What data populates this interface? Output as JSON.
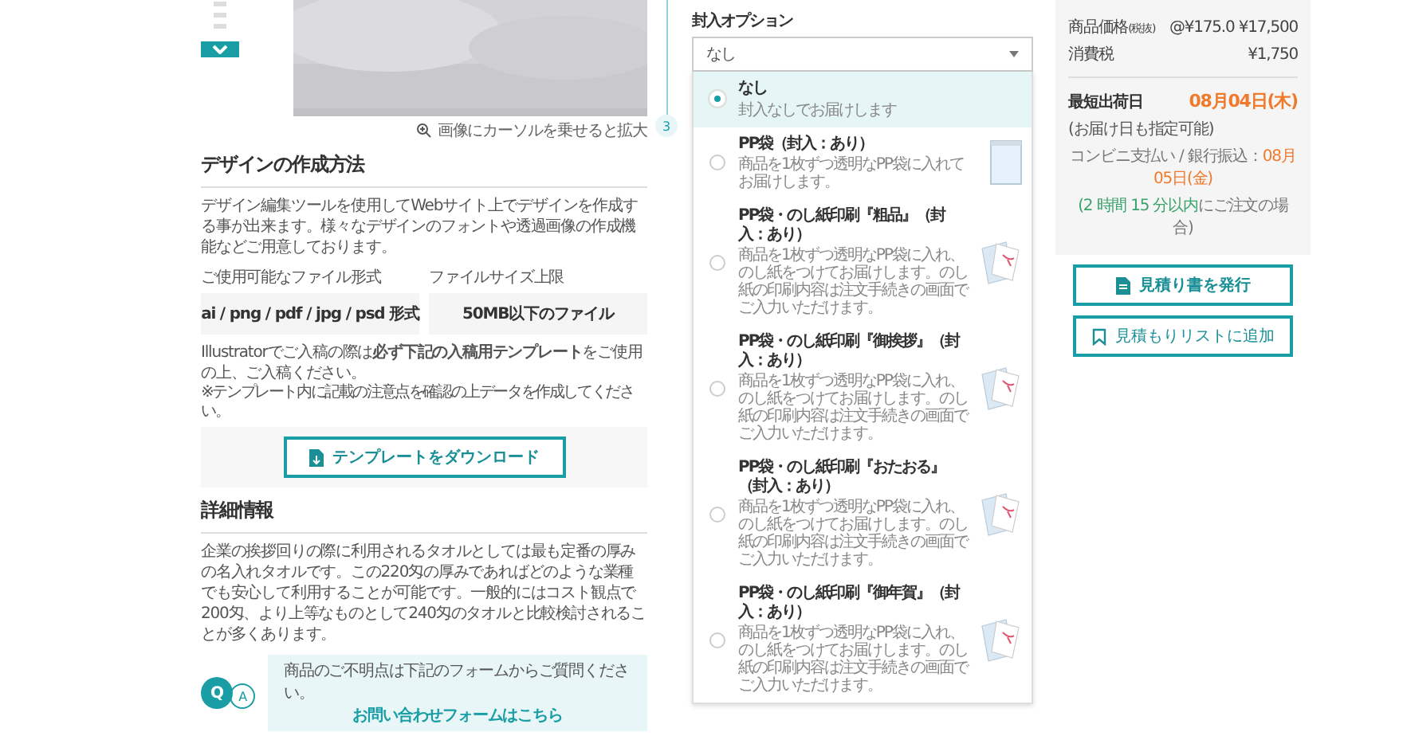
{
  "image_caption": "画像にカーソルを乗せると拡大",
  "design": {
    "heading": "デザインの作成方法",
    "description": "デザイン編集ツールを使用してWebサイト上でデザインを作成する事が出来ます。様々なデザインのフォントや透過画像の作成機能などご用意しております。",
    "file_format_label": "ご使用可能なファイル形式",
    "file_format": "ai / png / pdf / jpg / psd 形式",
    "size_label": "ファイルサイズ上限",
    "size": "50MB以下のファイル",
    "notice": "Illustratorでご入稿の際は**必ず下記の入稿用テンプレート**をご使用の上、ご入稿ください。",
    "note": "※テンプレート内に記載の注意点を確認の上データを作成してください。",
    "download_button": "テンプレートをダウンロード"
  },
  "details": {
    "heading": "詳細情報",
    "text": "企業の挨拶回りの際に利用されるタオルとしては最も定番の厚みの名入れタオルです。この220匁の厚みであればどのような業種でも安心して利用することが可能です。一般的にはコスト観点で200匁、より上等なものとして240匁のタオルと比較検討されることが多くあります。"
  },
  "inquiry": {
    "q": "Q",
    "a": "A",
    "text": "商品のご不明点は下記のフォームからご質問ください。",
    "link": "お問い合わせフォームはこちら"
  },
  "step": {
    "number": "3"
  },
  "enclosure": {
    "label": "封入オプション",
    "select_value": "なし",
    "options": [
      {
        "title": "なし",
        "description": "封入なしでお届けします",
        "selected": true,
        "kind": "none"
      },
      {
        "title": "PP袋（封入：あり）",
        "description": "商品を1枚ずつ透明なPP袋に入れてお届けします。",
        "selected": false,
        "kind": "bag"
      },
      {
        "title": "PP袋・のし紙印刷『粗品』（封入：あり）",
        "description": "商品を1枚ずつ透明なPP袋に入れ、のし紙をつけてお届けします。のし紙の印刷内容は注文手続きの画面でご入力いただけます。",
        "selected": false,
        "kind": "noshi"
      },
      {
        "title": "PP袋・のし紙印刷『御挨拶』（封入：あり）",
        "description": "商品を1枚ずつ透明なPP袋に入れ、のし紙をつけてお届けします。のし紙の印刷内容は注文手続きの画面でご入力いただけます。",
        "selected": false,
        "kind": "noshi"
      },
      {
        "title": "PP袋・のし紙印刷『おたおる』（封入：あり）",
        "description": "商品を1枚ずつ透明なPP袋に入れ、のし紙をつけてお届けします。のし紙の印刷内容は注文手続きの画面でご入力いただけます。",
        "selected": false,
        "kind": "noshi"
      },
      {
        "title": "PP袋・のし紙印刷『御年賀』（封入：あり）",
        "description": "商品を1枚ずつ透明なPP袋に入れ、のし紙をつけてお届けします。のし紙の印刷内容は注文手続きの画面でご入力いただけます。",
        "selected": false,
        "kind": "noshi"
      }
    ]
  },
  "summary": {
    "rows": [
      {
        "label": "商品価格",
        "label_note": "(税抜)",
        "value": "@¥175.0 ¥17,500"
      },
      {
        "label": "消費税",
        "value": "¥1,750"
      }
    ],
    "ship_label": "最短出荷日",
    "ship_date": "08月04日(木)",
    "ship_note": "(お届け日も指定可能)",
    "convenience": "コンビニ支払い / 銀行振込：",
    "convenience_date": "08月05日(金)",
    "deadline_time": "(2 時間 15 分以内",
    "deadline_rest": "にご注文の場合)"
  },
  "buttons": [
    {
      "label": "見積り書を発行",
      "kind": "document"
    },
    {
      "label": "見積もりリストに追加",
      "kind": "bookmark"
    }
  ]
}
